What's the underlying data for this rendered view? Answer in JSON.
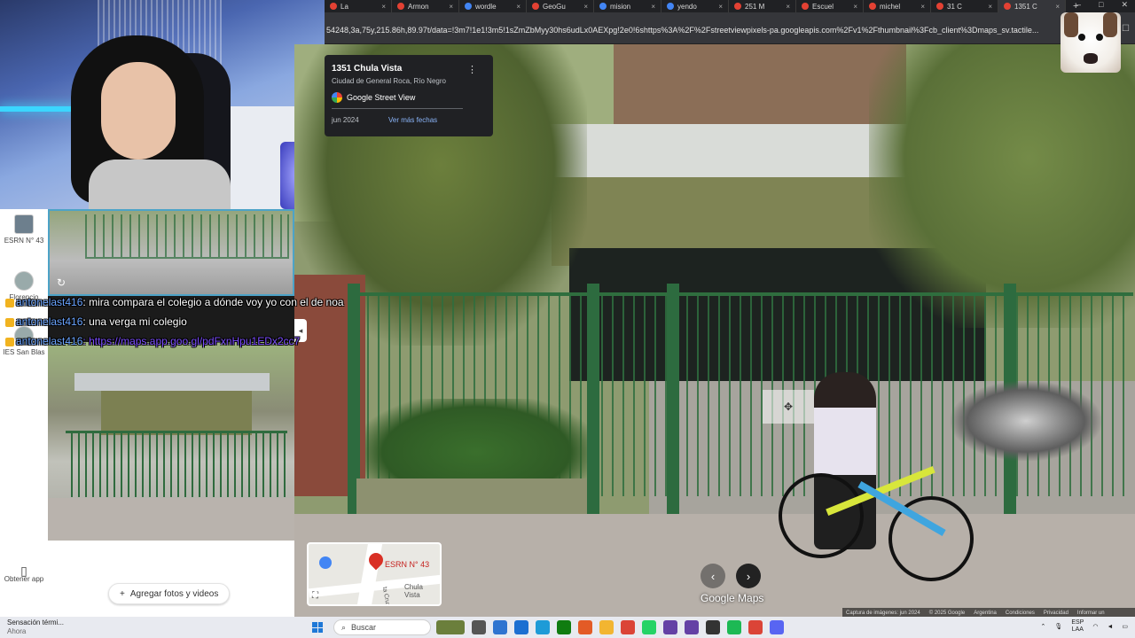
{
  "browser": {
    "tabs": [
      {
        "label": "La",
        "active": false
      },
      {
        "label": "Armon",
        "active": false
      },
      {
        "label": "wordle",
        "active": false
      },
      {
        "label": "GeoGu",
        "active": false
      },
      {
        "label": "mision",
        "active": false
      },
      {
        "label": "yendo",
        "active": false
      },
      {
        "label": "251 M",
        "active": false
      },
      {
        "label": "Escuel",
        "active": false
      },
      {
        "label": "michel",
        "active": false
      },
      {
        "label": "31 C",
        "active": false
      },
      {
        "label": "1351 C",
        "active": true
      }
    ],
    "url": "54248,3a,75y,215.86h,89.97t/data=!3m7!1e1!3m5!1sZmZbMyy30hs6udLx0AEXpg!2e0!6shttps%3A%2F%2Fstreetviewpixels-pa.googleapis.com%2Fv1%2Fthumbnail%3Fcb_client%3Dmaps_sv.tactile..."
  },
  "info_card": {
    "address": "1351 Chula Vista",
    "city": "Ciudad de General Roca, Río Negro",
    "source": "Google Street View",
    "date": "jun 2024",
    "more_dates": "Ver más fechas"
  },
  "left_rail": {
    "items": [
      {
        "label": "ESRN N° 43"
      },
      {
        "label": "Florencio"
      },
      {
        "label": "IES San Blas"
      },
      {
        "label": "Obtener app"
      }
    ]
  },
  "chat": [
    {
      "user": "antonelast416",
      "message": ": mira compara el colegio a dónde voy yo con el de noa"
    },
    {
      "user": "antonelast416",
      "message": ": una verga mi colegio"
    },
    {
      "user": "antonelast416",
      "message": ": https://maps.app.goo.gl/pdFxnHpu1EDx2cc7"
    }
  ],
  "panel": {
    "add_photos": "Agregar fotos y videos"
  },
  "streetview": {
    "brand": "Google Maps",
    "footer": [
      "Captura de imágenes: jun 2024",
      "© 2025 Google",
      "Argentina",
      "Condiciones",
      "Privacidad",
      "Informar un"
    ]
  },
  "minimap": {
    "place": "ESRN N° 43",
    "street": "Chula Vista",
    "street2": "ta Cruz"
  },
  "taskbar": {
    "weather_title": "Sensación térmi...",
    "weather_sub": "Ahora",
    "search_placeholder": "Buscar",
    "lang": "ESP",
    "lang_sub": "LAA"
  }
}
